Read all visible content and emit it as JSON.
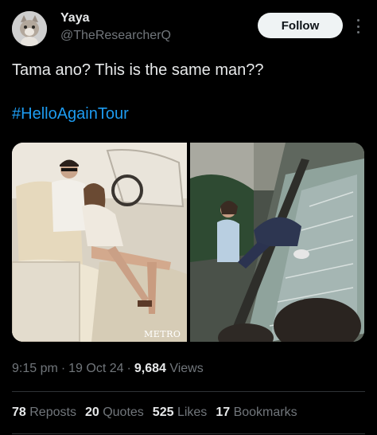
{
  "author": {
    "display_name": "Yaya",
    "handle": "@TheResearcherQ",
    "avatar_icon": "cat-avatar-icon"
  },
  "follow_label": "Follow",
  "tweet": {
    "text": "Tama ano? This is the same man??",
    "hashtag": "#HelloAgainTour"
  },
  "media": {
    "left_photo_watermark": "METRO"
  },
  "meta": {
    "time": "9:15 pm",
    "date": "19 Oct 24",
    "views_count": "9,684",
    "views_label": "Views"
  },
  "stats": {
    "reposts_count": "78",
    "reposts_label": "Reposts",
    "quotes_count": "20",
    "quotes_label": "Quotes",
    "likes_count": "525",
    "likes_label": "Likes",
    "bookmarks_count": "17",
    "bookmarks_label": "Bookmarks"
  },
  "colors": {
    "background": "#000000",
    "text_primary": "#e7e9ea",
    "text_secondary": "#71767b",
    "accent": "#1d9bf0",
    "divider": "#2f3336",
    "follow_bg": "#eff3f4"
  }
}
